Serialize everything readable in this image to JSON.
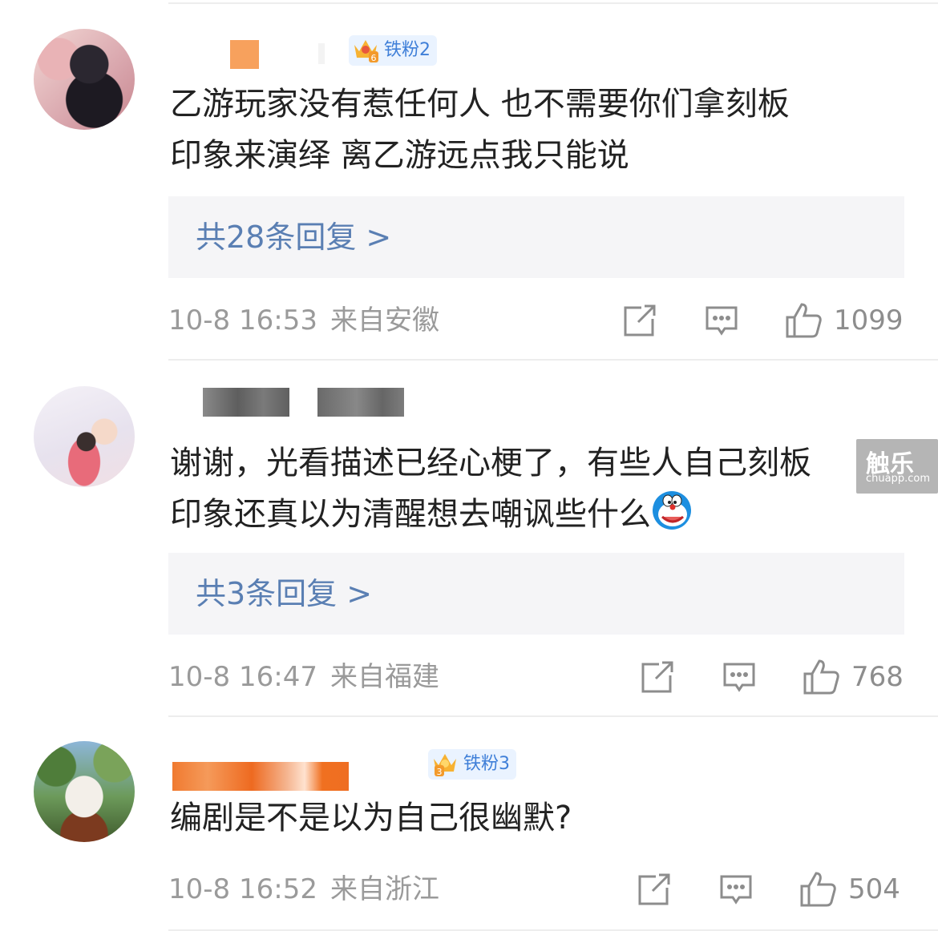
{
  "comments": [
    {
      "badge": "铁粉2",
      "badge_level": "6",
      "text_line1": "乙游玩家没有惹任何人 也不需要你们拿刻板",
      "text_line2": "印象来演绎 离乙游远点我只能说",
      "replies": "共28条回复 >",
      "time": "10-8 16:53",
      "location": "来自安徽",
      "likes": "1099"
    },
    {
      "text_line1": "谢谢，光看描述已经心梗了，有些人自己刻板",
      "text_line2": "印象还真以为清醒想去嘲讽些什么",
      "emoji": "doraemon-emoji",
      "replies": "共3条回复 >",
      "time": "10-8 16:47",
      "location": "来自福建",
      "likes": "768"
    },
    {
      "badge": "铁粉3",
      "badge_level": "3",
      "text_line1": "编剧是不是以为自己很幽默?",
      "time": "10-8 16:52",
      "location": "来自浙江",
      "likes": "504"
    }
  ],
  "watermark": {
    "brand": "触乐",
    "url": "chuapp.com"
  },
  "colors": {
    "link": "#5a7fb3",
    "meta": "#9a9a9a",
    "reply_bg": "#f5f5f7",
    "badge_bg": "#eaf3ff",
    "badge_text": "#3f7fd8"
  },
  "icons": [
    "repost-icon",
    "comment-icon",
    "like-icon",
    "crown-icon"
  ]
}
